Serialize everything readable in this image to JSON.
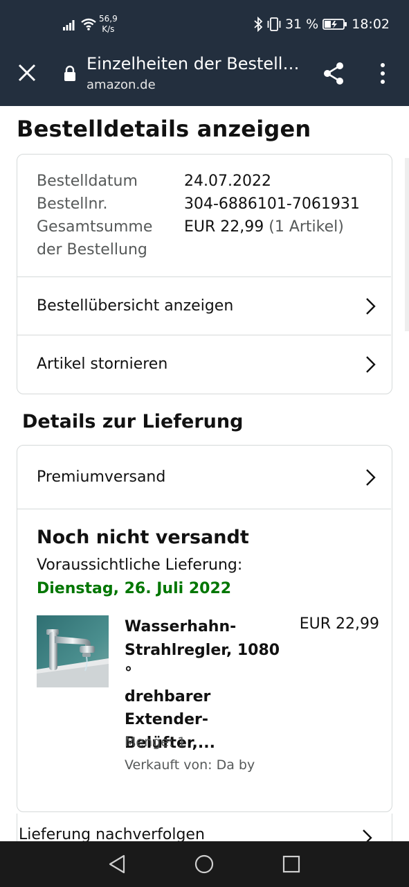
{
  "status_bar": {
    "net_speed_value": "56,9",
    "net_speed_unit": "K/s",
    "battery": "31 %",
    "time": "18:02"
  },
  "browser": {
    "page_title": "Einzelheiten der Bestellu…",
    "domain": "amazon.de"
  },
  "page": {
    "heading": "Bestelldetails anzeigen"
  },
  "order": {
    "date_label": "Bestelldatum",
    "date_value": "24.07.2022",
    "number_label": "Bestellnr.",
    "number_value": "304-6886101-7061931",
    "total_label_line1": "Gesamtsumme",
    "total_label_line2": "der Bestellung",
    "total_value": "EUR 22,99",
    "total_items": "(1 Artikel)"
  },
  "actions": {
    "view_summary": "Bestellübersicht anzeigen",
    "cancel_items": "Artikel stornieren"
  },
  "delivery": {
    "section_heading": "Details zur Lieferung",
    "shipping_method": "Premiumversand",
    "status": "Noch nicht versandt",
    "expected_label": "Voraussichtliche Lieferung:",
    "expected_date": "Dienstag, 26. Juli 2022",
    "track_label": "Lieferung nachverfolgen"
  },
  "product": {
    "title_lines": [
      "Wasserhahn-",
      "Strahlregler, 1080 °",
      "drehbarer",
      "Extender-",
      "Belüfter,..."
    ],
    "price": "EUR 22,99",
    "quantity": "Menge: 1",
    "seller": "Verkauft von: Da by"
  },
  "colors": {
    "header_bg": "#232f3e",
    "delivery_green": "#007600",
    "nav_bg": "#1a1a1a"
  }
}
